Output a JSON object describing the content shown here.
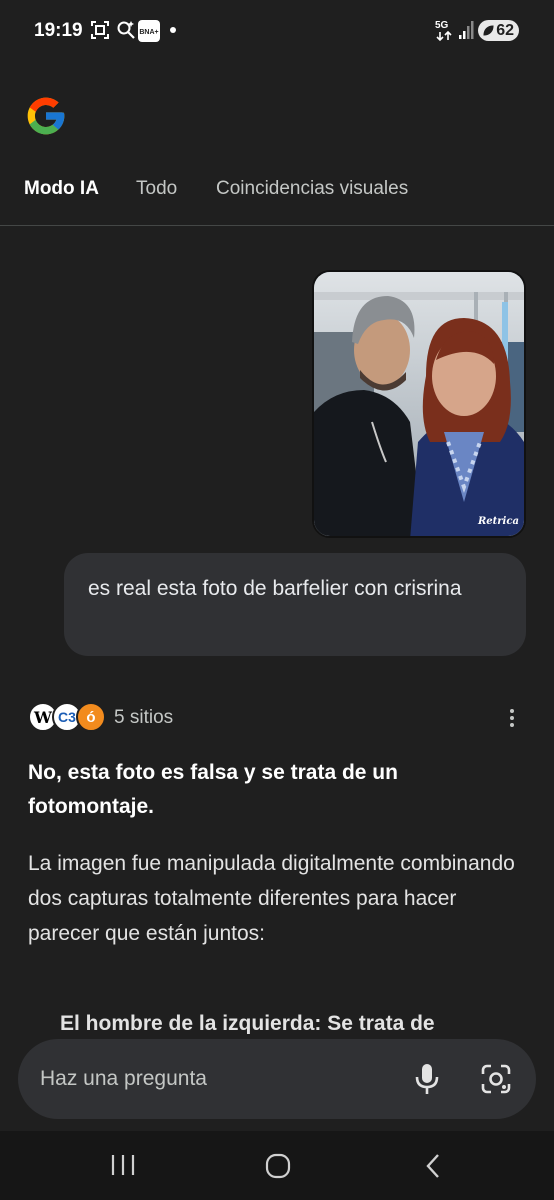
{
  "status_bar": {
    "time": "19:19",
    "icons": [
      "screenshot-icon",
      "search-sparkle-icon",
      "bna-app-icon",
      "notification-dot"
    ],
    "network_label": "5G",
    "battery_level": "62",
    "bna_label": "BNA+"
  },
  "tabs": [
    {
      "label": "Modo IA",
      "active": true
    },
    {
      "label": "Todo",
      "active": false
    },
    {
      "label": "Coincidencias visuales",
      "active": false
    }
  ],
  "uploaded_photo": {
    "watermark": "Retrica"
  },
  "query": {
    "text": "es real esta foto de barfelier con crisrina"
  },
  "sources": {
    "icons": [
      {
        "name": "wikipedia-icon",
        "glyph": "W"
      },
      {
        "name": "c3-icon",
        "glyph": "C3"
      },
      {
        "name": "orange-site-icon",
        "glyph": "ó"
      }
    ],
    "count_label": "5 sitios"
  },
  "answer": {
    "headline": "No, esta foto es falsa y se trata de un fotomontaje.",
    "body": "La imagen fue manipulada digitalmente combinando dos capturas totalmente diferentes para hacer parecer que están juntos:",
    "bullet_partial": "El hombre de la izquierda: Se trata de"
  },
  "ask_bar": {
    "placeholder": "Haz una pregunta"
  },
  "colors": {
    "background": "#1f1f1f",
    "bubble": "#303134",
    "text_primary": "#ffffff",
    "text_secondary": "#c4c7c5"
  }
}
